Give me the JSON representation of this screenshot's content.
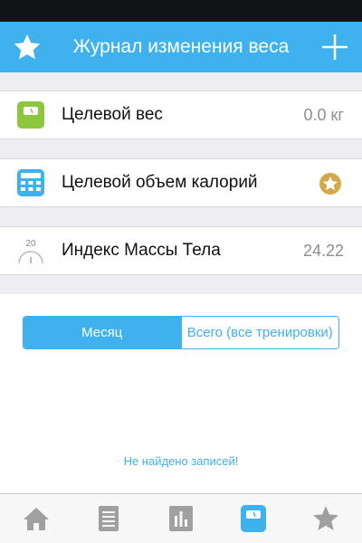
{
  "header": {
    "title": "Журнал изменения веса"
  },
  "rows": [
    {
      "label": "Целевой вес",
      "value": "0.0 кг"
    },
    {
      "label": "Целевой объем калорий"
    },
    {
      "label": "Индекс Массы Тела",
      "value": "24.22",
      "icon_number": "20"
    }
  ],
  "segments": {
    "month": "Месяц",
    "all": "Всего (все тренировки)"
  },
  "empty_message": "Не найдено записей!",
  "colors": {
    "accent": "#3fb1ec",
    "green": "#8dc63f",
    "gold": "#d4a94a",
    "tab_inactive": "#a0a0a0"
  },
  "tabs": [
    "home-icon",
    "journal-icon",
    "stats-icon",
    "scale-icon",
    "favorites-icon"
  ]
}
